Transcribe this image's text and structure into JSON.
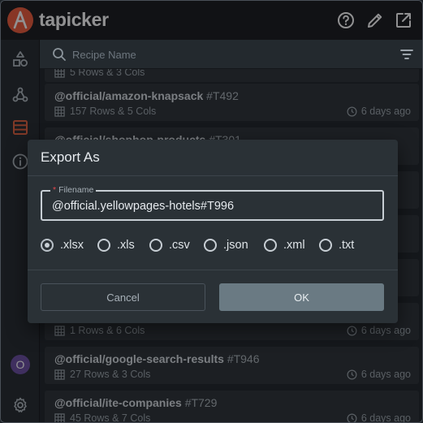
{
  "app": {
    "name": "tapicker",
    "brand_color": "#ee5a3a"
  },
  "header": {
    "actions": [
      {
        "icon": "help-circle-icon"
      },
      {
        "icon": "pencil-icon"
      },
      {
        "icon": "external-link-icon"
      }
    ]
  },
  "sidebar": {
    "items": [
      {
        "icon": "shapes-icon"
      },
      {
        "icon": "webhook-icon"
      },
      {
        "icon": "table-icon",
        "active": true,
        "active_color": "#e0603c"
      },
      {
        "icon": "info-icon"
      }
    ],
    "avatar_initial": "O",
    "settings_icon": "gear-icon"
  },
  "search": {
    "placeholder": "Recipe Name"
  },
  "list": {
    "partial_top_meta": "5 Rows & 3 Cols",
    "items": [
      {
        "title": "@official/amazon-knapsack",
        "id": "#T492",
        "meta": "157 Rows & 5 Cols",
        "time": "6 days ago"
      },
      {
        "title": "@official/shophop-products",
        "id": "#T301",
        "meta": "",
        "time": ""
      },
      {
        "title": "",
        "id": "",
        "meta": "1 Rows & 6 Cols",
        "time": "6 days ago"
      },
      {
        "title": "@official/google-search-results",
        "id": "#T946",
        "meta": "27 Rows & 3 Cols",
        "time": "6 days ago"
      },
      {
        "title": "@official/ite-companies",
        "id": "#T729",
        "meta": "45 Rows & 7 Cols",
        "time": "6 days ago"
      }
    ]
  },
  "dialog": {
    "title": "Export As",
    "filename_label": "Filename",
    "filename_value": "@official.yellowpages-hotels#T996",
    "formats": [
      {
        "label": ".xlsx",
        "checked": true
      },
      {
        "label": ".xls",
        "checked": false
      },
      {
        "label": ".csv",
        "checked": false
      },
      {
        "label": ".json",
        "checked": false
      },
      {
        "label": ".xml",
        "checked": false
      },
      {
        "label": ".txt",
        "checked": false
      }
    ],
    "cancel_label": "Cancel",
    "ok_label": "OK"
  }
}
